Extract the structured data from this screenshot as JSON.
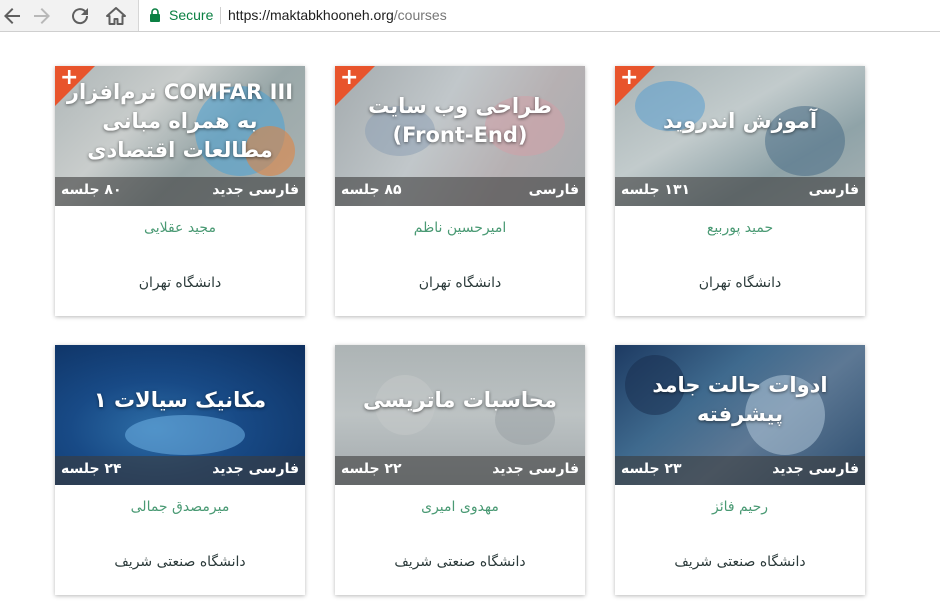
{
  "browser": {
    "secure_label": "Secure",
    "url_host": "https://maktabkhooneh.org",
    "url_path": "/courses"
  },
  "colors": {
    "ribbon": "#e8542c",
    "teacher": "#4a9a74",
    "university": "#2b3a3a",
    "secure": "#0b8043"
  },
  "courses": [
    {
      "title": "نرم‌افزار COMFAR III به همراه مبانی مطالعات اقتصادی",
      "lang": "فارسی  جدید",
      "sessions": "۸۰ جلسه",
      "teacher": "مجید عقلایی",
      "university": "دانشگاه تهران",
      "badge": "+"
    },
    {
      "title": "طراحی وب سایت (Front-End)",
      "lang": "فارسی",
      "sessions": "۸۵ جلسه",
      "teacher": "امیرحسین ناظم",
      "university": "دانشگاه تهران",
      "badge": "+"
    },
    {
      "title": "آموزش اندروید",
      "lang": "فارسی",
      "sessions": "۱۳۱ جلسه",
      "teacher": "حمید پوربیع",
      "university": "دانشگاه تهران",
      "badge": "+"
    },
    {
      "title": "مکانیک سیالات ۱",
      "lang": "فارسی  جدید",
      "sessions": "۲۴ جلسه",
      "teacher": "میرمصدق جمالی",
      "university": "دانشگاه صنعتی شریف"
    },
    {
      "title": "محاسبات ماتریسی",
      "lang": "فارسی  جدید",
      "sessions": "۲۲ جلسه",
      "teacher": "مهدوی امیری",
      "university": "دانشگاه صنعتی شریف"
    },
    {
      "title": "ادوات حالت جامد پیشرفته",
      "lang": "فارسی  جدید",
      "sessions": "۲۳ جلسه",
      "teacher": "رحیم فائز",
      "university": "دانشگاه صنعتی شریف"
    }
  ]
}
